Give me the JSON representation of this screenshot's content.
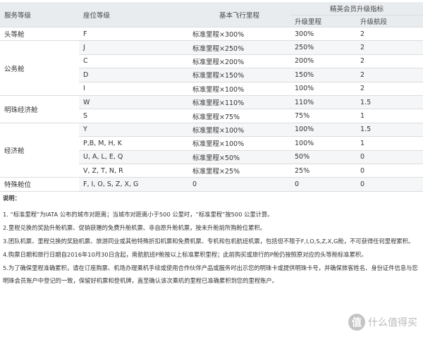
{
  "table": {
    "headers": {
      "service_class": "服务等级",
      "seat_class": "座位等级",
      "base_miles": "基本飞行里程",
      "elite_upgrade": "精英会员升级指标",
      "upgrade_miles": "升级里程",
      "upgrade_segments": "升级航段"
    },
    "groups": [
      {
        "service": "头等舱",
        "rows": [
          {
            "seat": "F",
            "base": "标准里程×300%",
            "miles": "300%",
            "segments": "2"
          }
        ]
      },
      {
        "service": "公务舱",
        "rows": [
          {
            "seat": "J",
            "base": "标准里程×250%",
            "miles": "250%",
            "segments": "2"
          },
          {
            "seat": "C",
            "base": "标准里程×200%",
            "miles": "200%",
            "segments": "2"
          },
          {
            "seat": "D",
            "base": "标准里程×150%",
            "miles": "150%",
            "segments": "2"
          },
          {
            "seat": "I",
            "base": "标准里程×100%",
            "miles": "100%",
            "segments": "2"
          }
        ]
      },
      {
        "service": "明珠经济舱",
        "rows": [
          {
            "seat": "W",
            "base": "标准里程×110%",
            "miles": "110%",
            "segments": "1.5"
          },
          {
            "seat": "S",
            "base": "标准里程×75%",
            "miles": "75%",
            "segments": "1"
          }
        ]
      },
      {
        "service": "经济舱",
        "rows": [
          {
            "seat": "Y",
            "base": "标准里程×100%",
            "miles": "100%",
            "segments": "1.5"
          },
          {
            "seat": "P,B, M, H, K",
            "base": "标准里程×100%",
            "miles": "100%",
            "segments": "1"
          },
          {
            "seat": "U, A, L, E, Q",
            "base": "标准里程×50%",
            "miles": "50%",
            "segments": "0"
          },
          {
            "seat": "V, Z, T, N, R",
            "base": "标准里程×25%",
            "miles": "25%",
            "segments": "0"
          }
        ]
      },
      {
        "service": "特殊舱位",
        "rows": [
          {
            "seat": "F, I, O, S, Z, X, G",
            "base": "0",
            "miles": "0",
            "segments": "0"
          }
        ]
      }
    ]
  },
  "notes": {
    "title": "说明：",
    "items": [
      "1. “标准里程”为IATA 公布的城市对距离；当城市对距离小于500 公里时，“标准里程”按500 公里计算。",
      "2.里程兑换的奖励升舱机票、促销获赠的免费升舱机票、非自愿升舱机票，按未升舱前所购舱位累积。",
      "3.团队机票、里程兑换的奖励机票、旅游同业或其他特殊折扣机票和免费机票、专机和包机航班机票，包括但不限于F,I,O,S,Z,X,G舱，不可获得任何里程累积。",
      "4.购票日期和旅行日期自2016年10月30日含起，南航航班P舱按以上标准累积里程；此前购买或旅行的P舱仍按照原对应的头等舱标准累积。",
      "5.为了确保里程准确累积，请在订座购票、机场办理乘机手续或使用合作伙伴产品或服务时出示您的明珠卡或提供明珠卡号，并确保旅客姓名、身份证件信息与您明珠会员账户中登记的一致，保留好机票和登机牌，直至确认该次乘机的里程已准确累积到您的里程账户。"
    ]
  },
  "watermark": {
    "text": "什么值得买",
    "logo_char": "值"
  }
}
